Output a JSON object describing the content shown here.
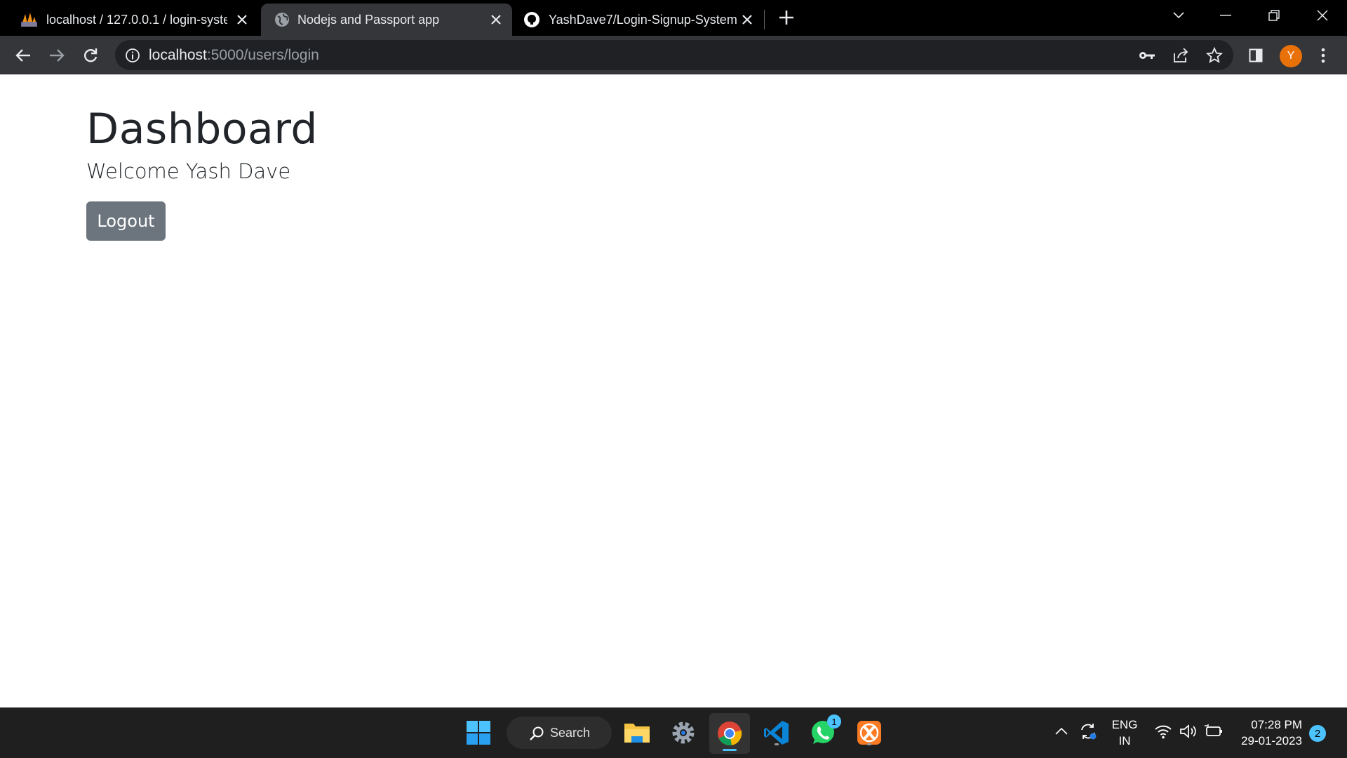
{
  "browser": {
    "tabs": [
      {
        "title": "localhost / 127.0.0.1 / login-syste",
        "favicon": "phpmyadmin-icon",
        "active": false
      },
      {
        "title": "Nodejs and Passport app",
        "favicon": "globe-icon",
        "active": true
      },
      {
        "title": "YashDave7/Login-Signup-System",
        "favicon": "github-icon",
        "active": false
      }
    ],
    "address": {
      "host": "localhost",
      "rest": ":5000/users/login"
    },
    "profile_initial": "Y",
    "colors": {
      "tabstrip": "#000000",
      "toolbar": "#35363a",
      "omnibox": "#202124",
      "avatar": "#e8710a"
    }
  },
  "page": {
    "title": "Dashboard",
    "welcome": "Welcome Yash Dave",
    "logout_label": "Logout",
    "colors": {
      "button": "#6c757d",
      "text": "#212529"
    }
  },
  "taskbar": {
    "search_label": "Search",
    "apps": [
      "windows-start-icon",
      "file-explorer-icon",
      "settings-icon",
      "chrome-icon",
      "vscode-icon",
      "whatsapp-icon",
      "xampp-icon"
    ],
    "whatsapp_badge": "1",
    "lang_line1": "ENG",
    "lang_line2": "IN",
    "time": "07:28 PM",
    "date": "29-01-2023",
    "notification_count": "2"
  }
}
